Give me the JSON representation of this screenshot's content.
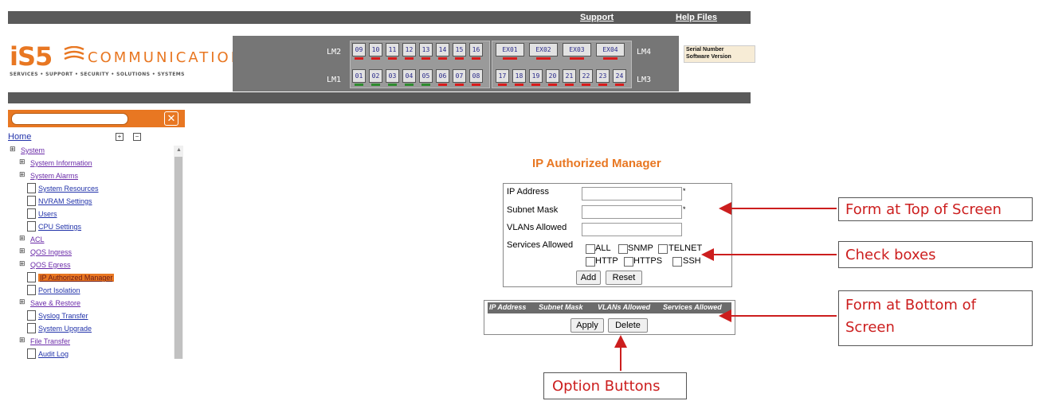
{
  "header": {
    "links": [
      "Support",
      "Help Files"
    ],
    "serial_lines": [
      "Serial Number",
      "Software Version"
    ]
  },
  "logo": {
    "mark": "iS5",
    "name": "COMMUNICATIONS",
    "tagline": "SERVICES • SUPPORT • SECURITY • SOLUTIONS • SYSTEMS"
  },
  "port_panel": {
    "labels": {
      "lm2": "LM2",
      "lm1": "LM1",
      "lm4": "LM4",
      "lm3": "LM3"
    },
    "top_ports": [
      "09",
      "10",
      "11",
      "12",
      "13",
      "14",
      "15",
      "16"
    ],
    "expansion_ports": [
      "EX01",
      "EX02",
      "EX03",
      "EX04"
    ],
    "bottom_ports_a": [
      "01",
      "02",
      "03",
      "04",
      "05",
      "06",
      "07",
      "08"
    ],
    "bottom_ports_b": [
      "17",
      "18",
      "19",
      "20",
      "21",
      "22",
      "23",
      "24"
    ],
    "status_colors": {
      "down": "#d81b1b",
      "up": "#2e8b2e"
    }
  },
  "sidebar": {
    "close_glyph": "✕",
    "home": "Home",
    "expand_glyph": "+",
    "collapse_glyph": "−",
    "items": [
      "System",
      "System Information",
      "System Alarms",
      "System Resources",
      "NVRAM Settings",
      "Users",
      "CPU Settings",
      "ACL",
      "QOS Ingress",
      "QOS Egress",
      "IP Authorized Manager",
      "Port Isolation",
      "Save & Restore",
      "Syslog Transfer",
      "System Upgrade",
      "File Transfer",
      "Audit Log"
    ],
    "selected": "IP Authorized Manager"
  },
  "main": {
    "title": "IP Authorized Manager",
    "form": {
      "ip_label": "IP Address",
      "mask_label": "Subnet Mask",
      "vlans_label": "VLANs Allowed",
      "services_label": "Services Allowed",
      "required_mark": "*",
      "services": [
        "ALL",
        "SNMP",
        "TELNET",
        "HTTP",
        "HTTPS",
        "SSH"
      ],
      "add": "Add",
      "reset": "Reset"
    },
    "table": {
      "headers": [
        "IP Address",
        "Subnet Mask",
        "VLANs Allowed",
        "Services Allowed"
      ],
      "apply": "Apply",
      "delete": "Delete"
    }
  },
  "callouts": {
    "form_top": "Form at Top of Screen",
    "check_boxes": "Check boxes",
    "form_bottom": "Form at Bottom of Screen",
    "option_buttons": "Option Buttons",
    "color": "#cc1e1e"
  },
  "colors": {
    "accent": "#e87722",
    "dark_bar": "#5a5a5a"
  }
}
